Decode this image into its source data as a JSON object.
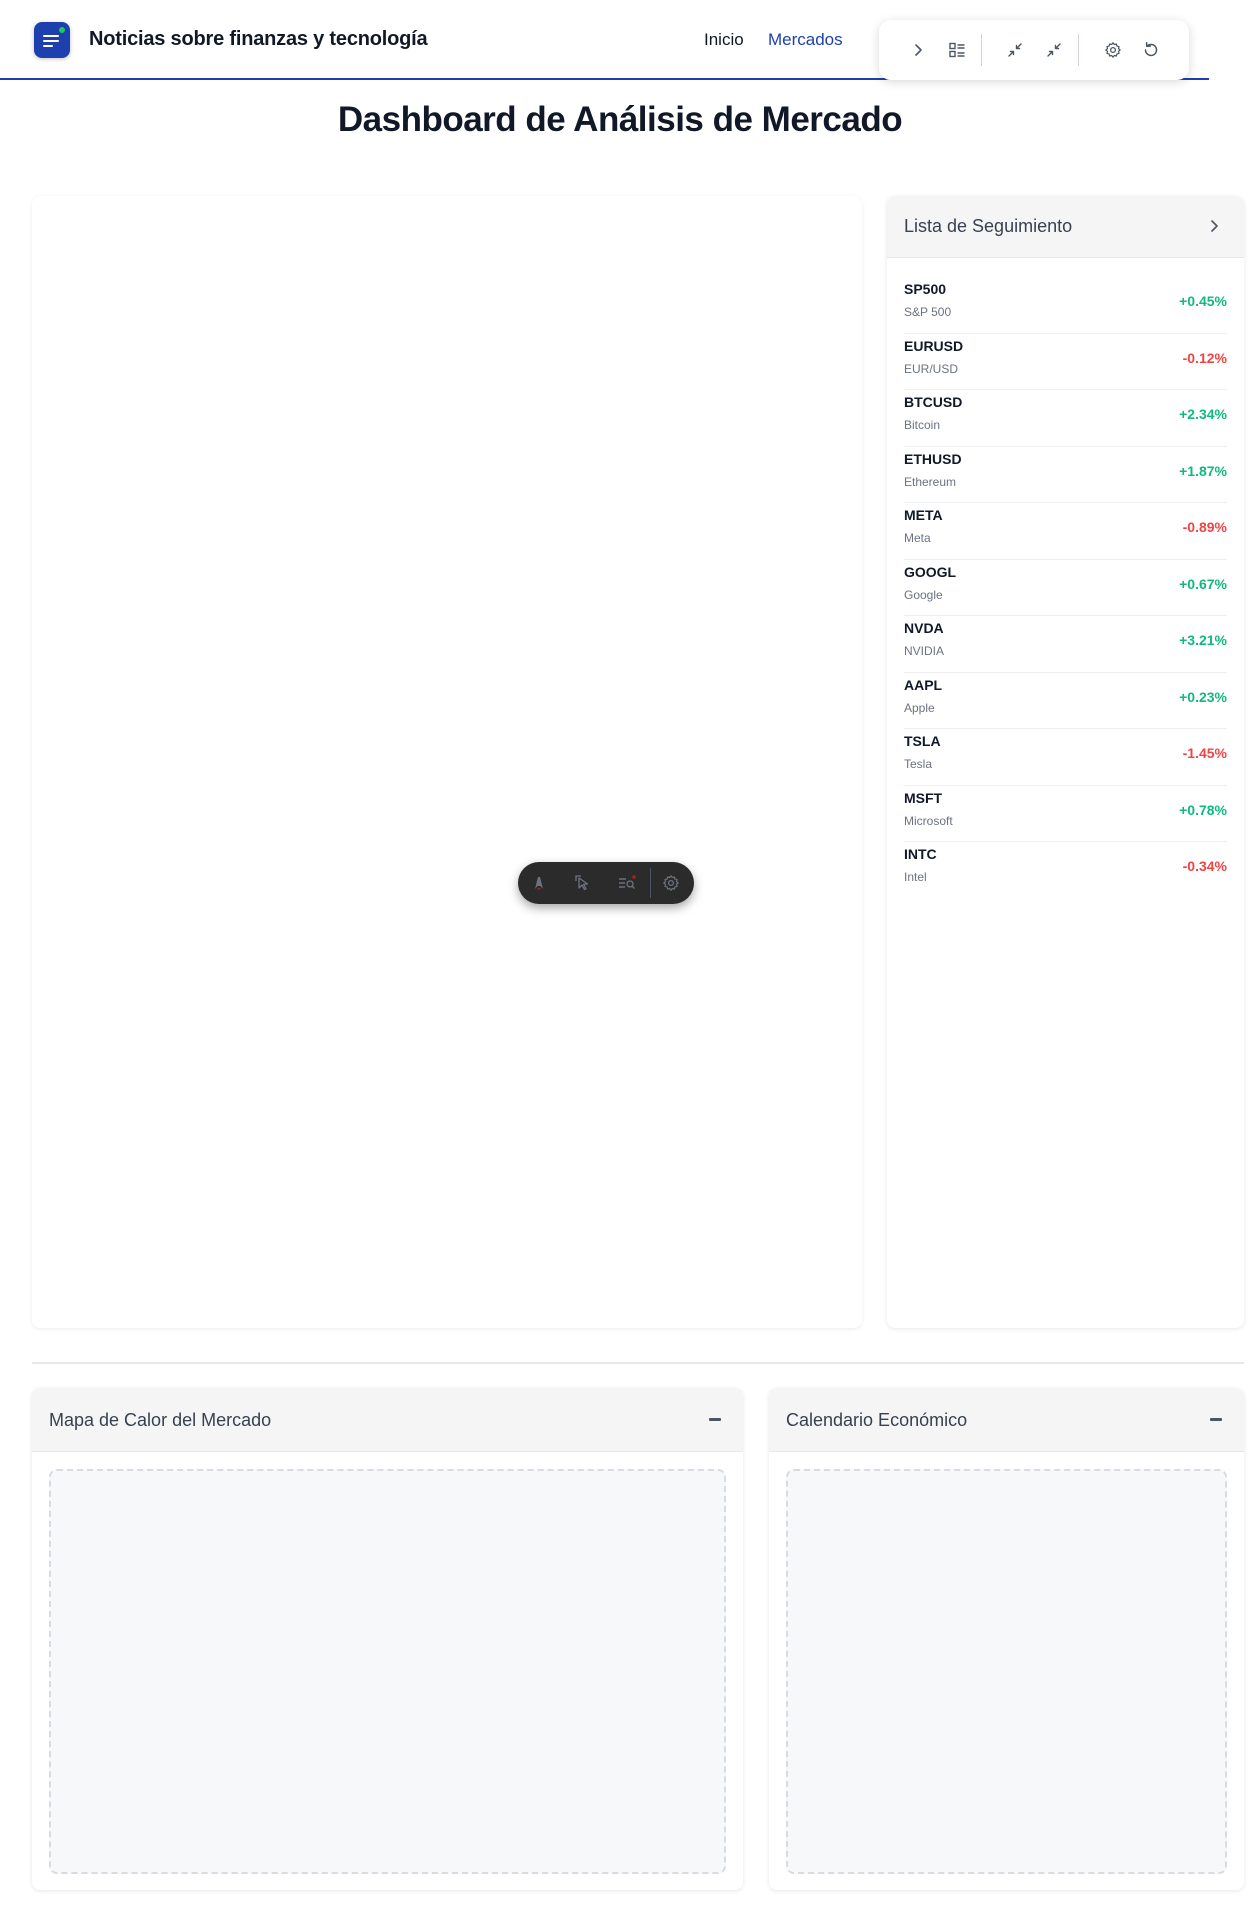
{
  "header": {
    "site_title": "Noticias sobre finanzas y tecnología",
    "nav": [
      {
        "label": "Inicio"
      },
      {
        "label": "Mercados"
      }
    ],
    "accent_color": "#1e40af"
  },
  "toolbar": {
    "icons": [
      "chevron-right-icon",
      "list-layout-icon",
      "collapse-icon",
      "shrink-icon",
      "gear-icon",
      "refresh-icon"
    ]
  },
  "page": {
    "title": "Dashboard de Análisis de Mercado"
  },
  "watchlist": {
    "title": "Lista de Seguimiento",
    "up_color": "#10b981",
    "down_color": "#ef4444",
    "items": [
      {
        "symbol": "SP500",
        "name": "S&P 500",
        "change": "+0.45%",
        "direction": "up"
      },
      {
        "symbol": "EURUSD",
        "name": "EUR/USD",
        "change": "-0.12%",
        "direction": "down"
      },
      {
        "symbol": "BTCUSD",
        "name": "Bitcoin",
        "change": "+2.34%",
        "direction": "up"
      },
      {
        "symbol": "ETHUSD",
        "name": "Ethereum",
        "change": "+1.87%",
        "direction": "up"
      },
      {
        "symbol": "META",
        "name": "Meta",
        "change": "-0.89%",
        "direction": "down"
      },
      {
        "symbol": "GOOGL",
        "name": "Google",
        "change": "+0.67%",
        "direction": "up"
      },
      {
        "symbol": "NVDA",
        "name": "NVIDIA",
        "change": "+3.21%",
        "direction": "up"
      },
      {
        "symbol": "AAPL",
        "name": "Apple",
        "change": "+0.23%",
        "direction": "up"
      },
      {
        "symbol": "TSLA",
        "name": "Tesla",
        "change": "-1.45%",
        "direction": "down"
      },
      {
        "symbol": "MSFT",
        "name": "Microsoft",
        "change": "+0.78%",
        "direction": "up"
      },
      {
        "symbol": "INTC",
        "name": "Intel",
        "change": "-0.34%",
        "direction": "down"
      }
    ]
  },
  "panels": {
    "heatmap": {
      "title": "Mapa de Calor del Mercado"
    },
    "calendar": {
      "title": "Calendario Económico"
    }
  }
}
